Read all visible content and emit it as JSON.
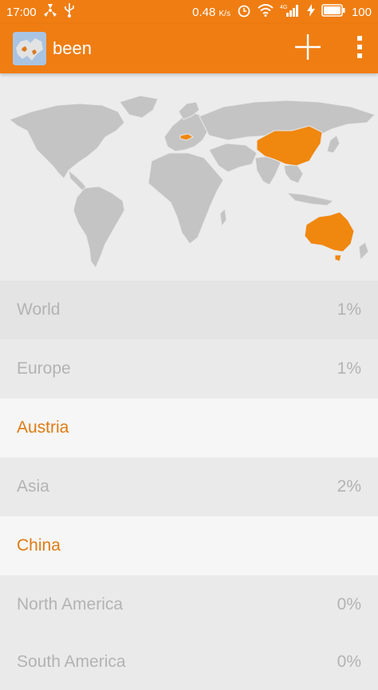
{
  "status_bar": {
    "time": "17:00",
    "speed": "0.48",
    "speed_unit": "K/s",
    "signal_type": "4G",
    "battery": "100",
    "icons": [
      "fan-icon",
      "usb-icon",
      "alarm-icon",
      "wifi-icon",
      "signal-icon",
      "charging-icon",
      "battery-icon"
    ]
  },
  "app_bar": {
    "title": "been",
    "add_icon": "plus-icon",
    "menu_icon": "more-vert-icon"
  },
  "map": {
    "land_color": "#c4c4c4",
    "highlight_color": "#f0870f",
    "highlighted_countries": [
      "Austria",
      "China",
      "Australia"
    ]
  },
  "list": [
    {
      "label": "World",
      "pct": "1%",
      "kind": "region"
    },
    {
      "label": "Europe",
      "pct": "1%",
      "kind": "region"
    },
    {
      "label": "Austria",
      "pct": "",
      "kind": "country"
    },
    {
      "label": "Asia",
      "pct": "2%",
      "kind": "region"
    },
    {
      "label": "China",
      "pct": "",
      "kind": "country"
    },
    {
      "label": "North America",
      "pct": "0%",
      "kind": "region"
    },
    {
      "label": "South America",
      "pct": "0%",
      "kind": "region"
    }
  ],
  "colors": {
    "accent": "#ef7d12",
    "country_text": "#de7b12",
    "region_text": "#b3b3b3"
  }
}
